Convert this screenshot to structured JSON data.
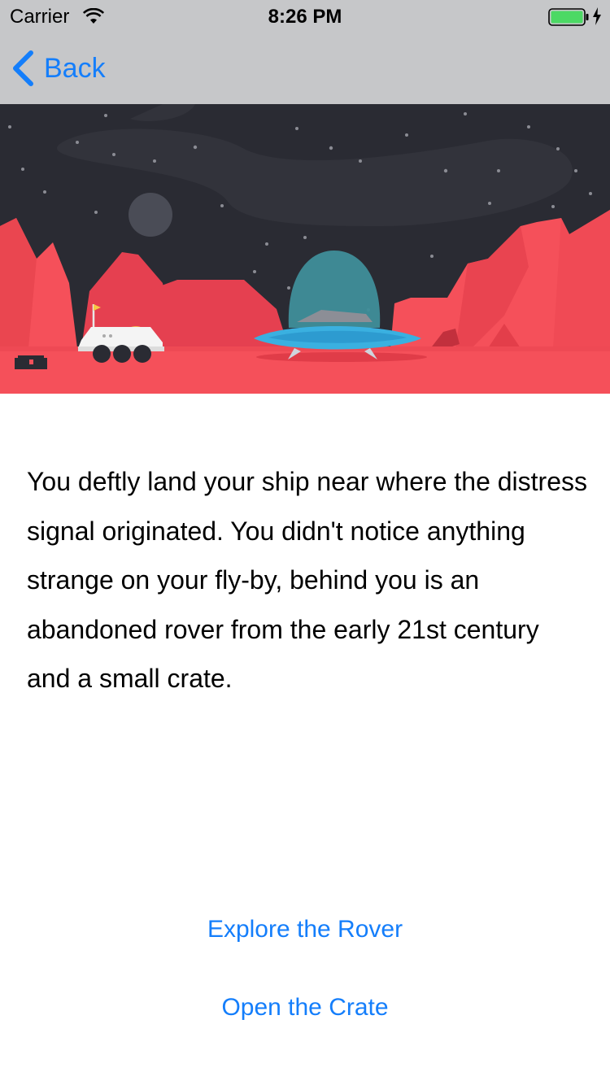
{
  "status_bar": {
    "carrier": "Carrier",
    "time": "8:26 PM",
    "wifi_icon": "wifi-icon",
    "battery_icon": "battery-full-icon",
    "battery_color": "#4cd964"
  },
  "nav": {
    "back_label": "Back",
    "back_icon": "chevron-left-icon",
    "tint_color": "#147efb"
  },
  "illustration": {
    "description_icon": "mars-landing-illustration",
    "sky_color": "#2a2b33",
    "ground_color": "#f5505a"
  },
  "story": {
    "text": "You deftly land your ship near where the distress signal originated. You didn't notice anything strange on your fly-by, behind you is an abandoned rover from the early 21st century and a small crate."
  },
  "choices": [
    {
      "label": "Explore the Rover"
    },
    {
      "label": "Open the Crate"
    }
  ]
}
